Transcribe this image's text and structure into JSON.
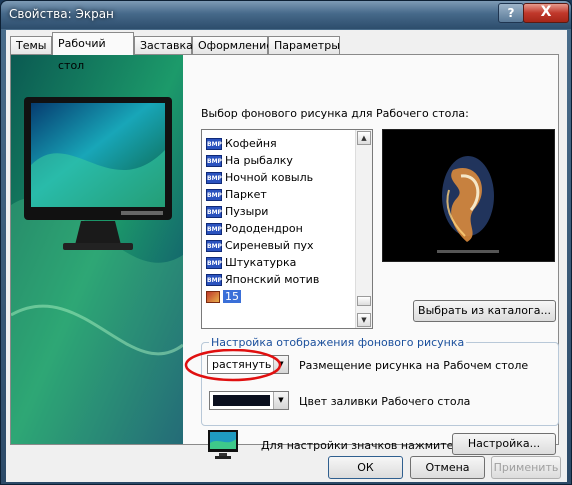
{
  "window": {
    "title": "Свойства: Экран",
    "help_glyph": "?",
    "close_glyph": "X"
  },
  "tabs": [
    "Темы",
    "Рабочий стол",
    "Заставка",
    "Оформление",
    "Параметры"
  ],
  "active_tab": "Рабочий стол",
  "background": {
    "heading": "Выбор фонового рисунка для Рабочего стола:",
    "items": [
      {
        "label": "Кофейня",
        "icon": "bmp-icon",
        "badge": "BMP"
      },
      {
        "label": "На рыбалку",
        "icon": "bmp-icon",
        "badge": "BMP"
      },
      {
        "label": "Ночной ковыль",
        "icon": "bmp-icon",
        "badge": "BMP"
      },
      {
        "label": "Паркет",
        "icon": "bmp-icon",
        "badge": "BMP"
      },
      {
        "label": "Пузыри",
        "icon": "bmp-icon",
        "badge": "BMP"
      },
      {
        "label": "Рододендрон",
        "icon": "bmp-icon",
        "badge": "BMP"
      },
      {
        "label": "Сиреневый пух",
        "icon": "bmp-icon",
        "badge": "BMP"
      },
      {
        "label": "Штукатурка",
        "icon": "bmp-icon",
        "badge": "BMP"
      },
      {
        "label": "Японский мотив",
        "icon": "bmp-icon",
        "badge": "BMP"
      },
      {
        "label": "15",
        "icon": "image-file-icon",
        "selected": true
      }
    ],
    "browse_button": "Выбрать из каталога..."
  },
  "display_settings": {
    "legend": "Настройка отображения фонового рисунка",
    "position_value": "растянуть",
    "position_label": "Размещение рисунка на Рабочем столе",
    "fill_color": "#0a0f1e",
    "fill_label": "Цвет заливки Рабочего стола"
  },
  "icons_setup": {
    "label": "Для настройки значков нажмите:",
    "button": "Настройка..."
  },
  "footer": {
    "ok": "ОК",
    "cancel": "Отмена",
    "apply": "Применить"
  },
  "colors": {
    "accent_blue": "#1a4f9c",
    "selection": "#3a6fd8",
    "annotation_red": "#e01010"
  }
}
